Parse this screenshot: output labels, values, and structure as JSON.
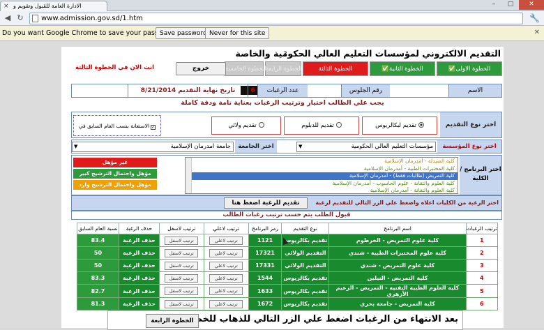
{
  "browser": {
    "tab_title": "الادارة العامة للقبول وتقويم و",
    "url": "www.admission.gov.sd/1.htm",
    "password_prompt": "Do you want Google Chrome to save your password?",
    "save_password_label": "Save password",
    "never_label": "Never for this site"
  },
  "page": {
    "title": "التقديم الالكتروني لمؤسسات التعليم العالي الحكومية والخاصة",
    "title_num": "3",
    "steps": [
      {
        "label": "✅الخطوة الاولى"
      },
      {
        "label": "✅الخطوة الثانية"
      },
      {
        "label": "الخطوة الثالثة"
      },
      {
        "label": "الخطوة الرابعة"
      },
      {
        "label": "الخطوة الخامسة"
      }
    ],
    "exit_label": "خروج",
    "now_step": "انت الان في الخطوة الثالثة",
    "info": {
      "name_label": "الاسم",
      "seat_label": "رقم الجلوس",
      "wishes_label": "عدد الرغبات",
      "wishes_value": "6",
      "deadline": "تاريخ نهاية التقديم 8/21/2014"
    },
    "notice": "يجب علي الطالب اختيار وترتيب الرغبات بعناية تامة ودقة كاملة",
    "apply_type": {
      "label": "اختر نوع التقديم",
      "opt_bachelor": "تقديم لبكالريوس",
      "opt_diploma": "تقديم للدبلوم",
      "opt_state": "تقديم ولائي",
      "check_label": "الاستعانة بنسب العام السابق في الترتيب"
    },
    "institution": {
      "type_label": "اختر نوع المؤسسة",
      "type_value": "مؤسسات التعليم العالي الحكومية",
      "uni_label": "اختر الجامعة",
      "uni_value": "جامعة امدرمان الإسلامية"
    },
    "program": {
      "label": "اختر البرنامج / الكلية",
      "items": [
        "كلية الصيدلة - أمدرمان الإسلامية",
        "كلية المختبرات الطبية - أمدرمان الإسلامية",
        "كلية التمريض (طالبات فقط) - أمدرمان الإسلامية",
        "كلية العلوم والتقانة - علوم الحاسوب - أمدرمان الإسلامية",
        "كلية العلوم والتقانة - أمدرمان الإسلامية"
      ]
    },
    "legend": {
      "not_qualified": "غير مؤهل",
      "qualified_high": "مؤهل واحتمال الترشيح كبير",
      "qualified_low": "مؤهل واحتمال الترشيح وارد"
    },
    "apply_text": "اختر الرغبة من الكليات اعلاه واضغط علي الزر التالي للتقديم لرغبة",
    "apply_button": "تقديم للرغبة اضغط هنا",
    "accepted_text": "قبول الطلب يتم حسب ترتيب رغبات الطالب",
    "table": {
      "headers": [
        "ترتيب الرغبات",
        "اسم البرنامج",
        "نوع التقديم",
        "رمز البرنامج",
        "ترتيب لاعلي",
        "ترتيب لاسفل",
        "حذف الرغبة",
        "نسبة العام السابق"
      ],
      "up_label": "ترتيب لاعلي",
      "down_label": "ترتيب لاسفل",
      "delete_label": "حذف الرغبة",
      "rows": [
        {
          "rank": "1",
          "program": "كلية علوم التمريض - الخرطوم",
          "type": "تقديم بكالريوس",
          "code": "1121",
          "rate": "83.4"
        },
        {
          "rank": "2",
          "program": "كلية علوم المختبرات الطبية - شندي",
          "type": "التقديم الولائي",
          "code": "17321",
          "rate": "50"
        },
        {
          "rank": "3",
          "program": "كلية علوم التمريض - شندي",
          "type": "التقديم الولائي",
          "code": "17331",
          "rate": "50"
        },
        {
          "rank": "4",
          "program": "كلية التمريض - النيلين",
          "type": "تقديم بكالريوس",
          "code": "1544",
          "rate": "83.3"
        },
        {
          "rank": "5",
          "program": "كلية العلوم الطبية التقنية - التمريض - الزعيم الأزهري",
          "type": "تقديم بكالريوس",
          "code": "1633",
          "rate": "82.7"
        },
        {
          "rank": "6",
          "program": "كلية التمريض - جامعة بحري",
          "type": "تقديم بكالريوس",
          "code": "1672",
          "rate": "81.3"
        }
      ]
    },
    "bottom_msg": "بعد الانتهاء من الرغبات اضغط علي الزر التالي للذهاب للخطوة الرابعة",
    "next_button": "الخطوة الرابعة"
  }
}
